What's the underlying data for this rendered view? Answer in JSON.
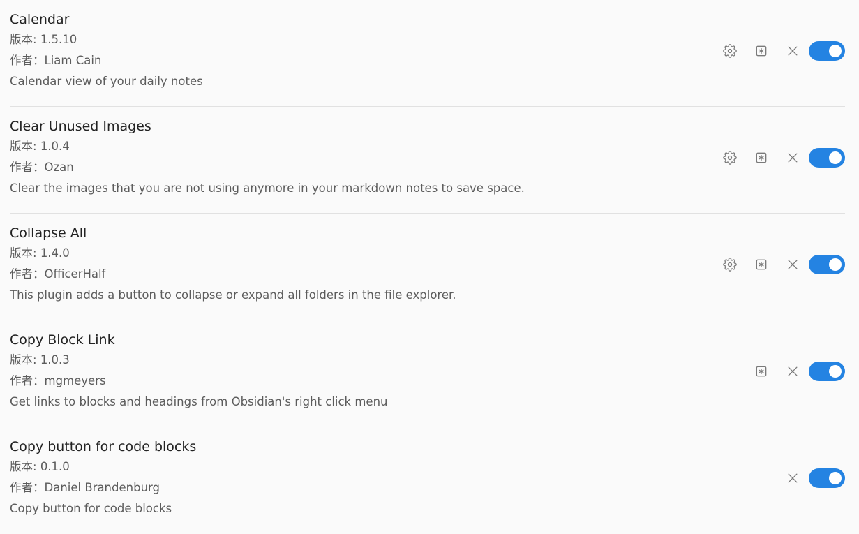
{
  "labels": {
    "version_prefix": "版本: ",
    "author_prefix": "作者："
  },
  "plugins": [
    {
      "name": "Calendar",
      "version": "1.5.10",
      "author": "Liam Cain",
      "description": "Calendar view of your daily notes",
      "has_settings": true,
      "has_hotkeys": true,
      "enabled": true
    },
    {
      "name": "Clear Unused Images",
      "version": "1.0.4",
      "author": "Ozan",
      "description": "Clear the images that you are not using anymore in your markdown notes to save space.",
      "has_settings": true,
      "has_hotkeys": true,
      "enabled": true
    },
    {
      "name": "Collapse All",
      "version": "1.4.0",
      "author": "OfficerHalf",
      "description": "This plugin adds a button to collapse or expand all folders in the file explorer.",
      "has_settings": true,
      "has_hotkeys": true,
      "enabled": true
    },
    {
      "name": "Copy Block Link",
      "version": "1.0.3",
      "author": "mgmeyers",
      "description": "Get links to blocks and headings from Obsidian's right click menu",
      "has_settings": false,
      "has_hotkeys": true,
      "enabled": true
    },
    {
      "name": "Copy button for code blocks",
      "version": "0.1.0",
      "author": "Daniel Brandenburg",
      "description": "Copy button for code blocks",
      "has_settings": false,
      "has_hotkeys": false,
      "enabled": true
    }
  ],
  "colors": {
    "toggle_on": "#2483e2",
    "icon": "#7a7a7a"
  },
  "icons": {
    "settings": "gear-icon",
    "hotkeys": "hotkey-icon",
    "uninstall": "close-icon"
  }
}
